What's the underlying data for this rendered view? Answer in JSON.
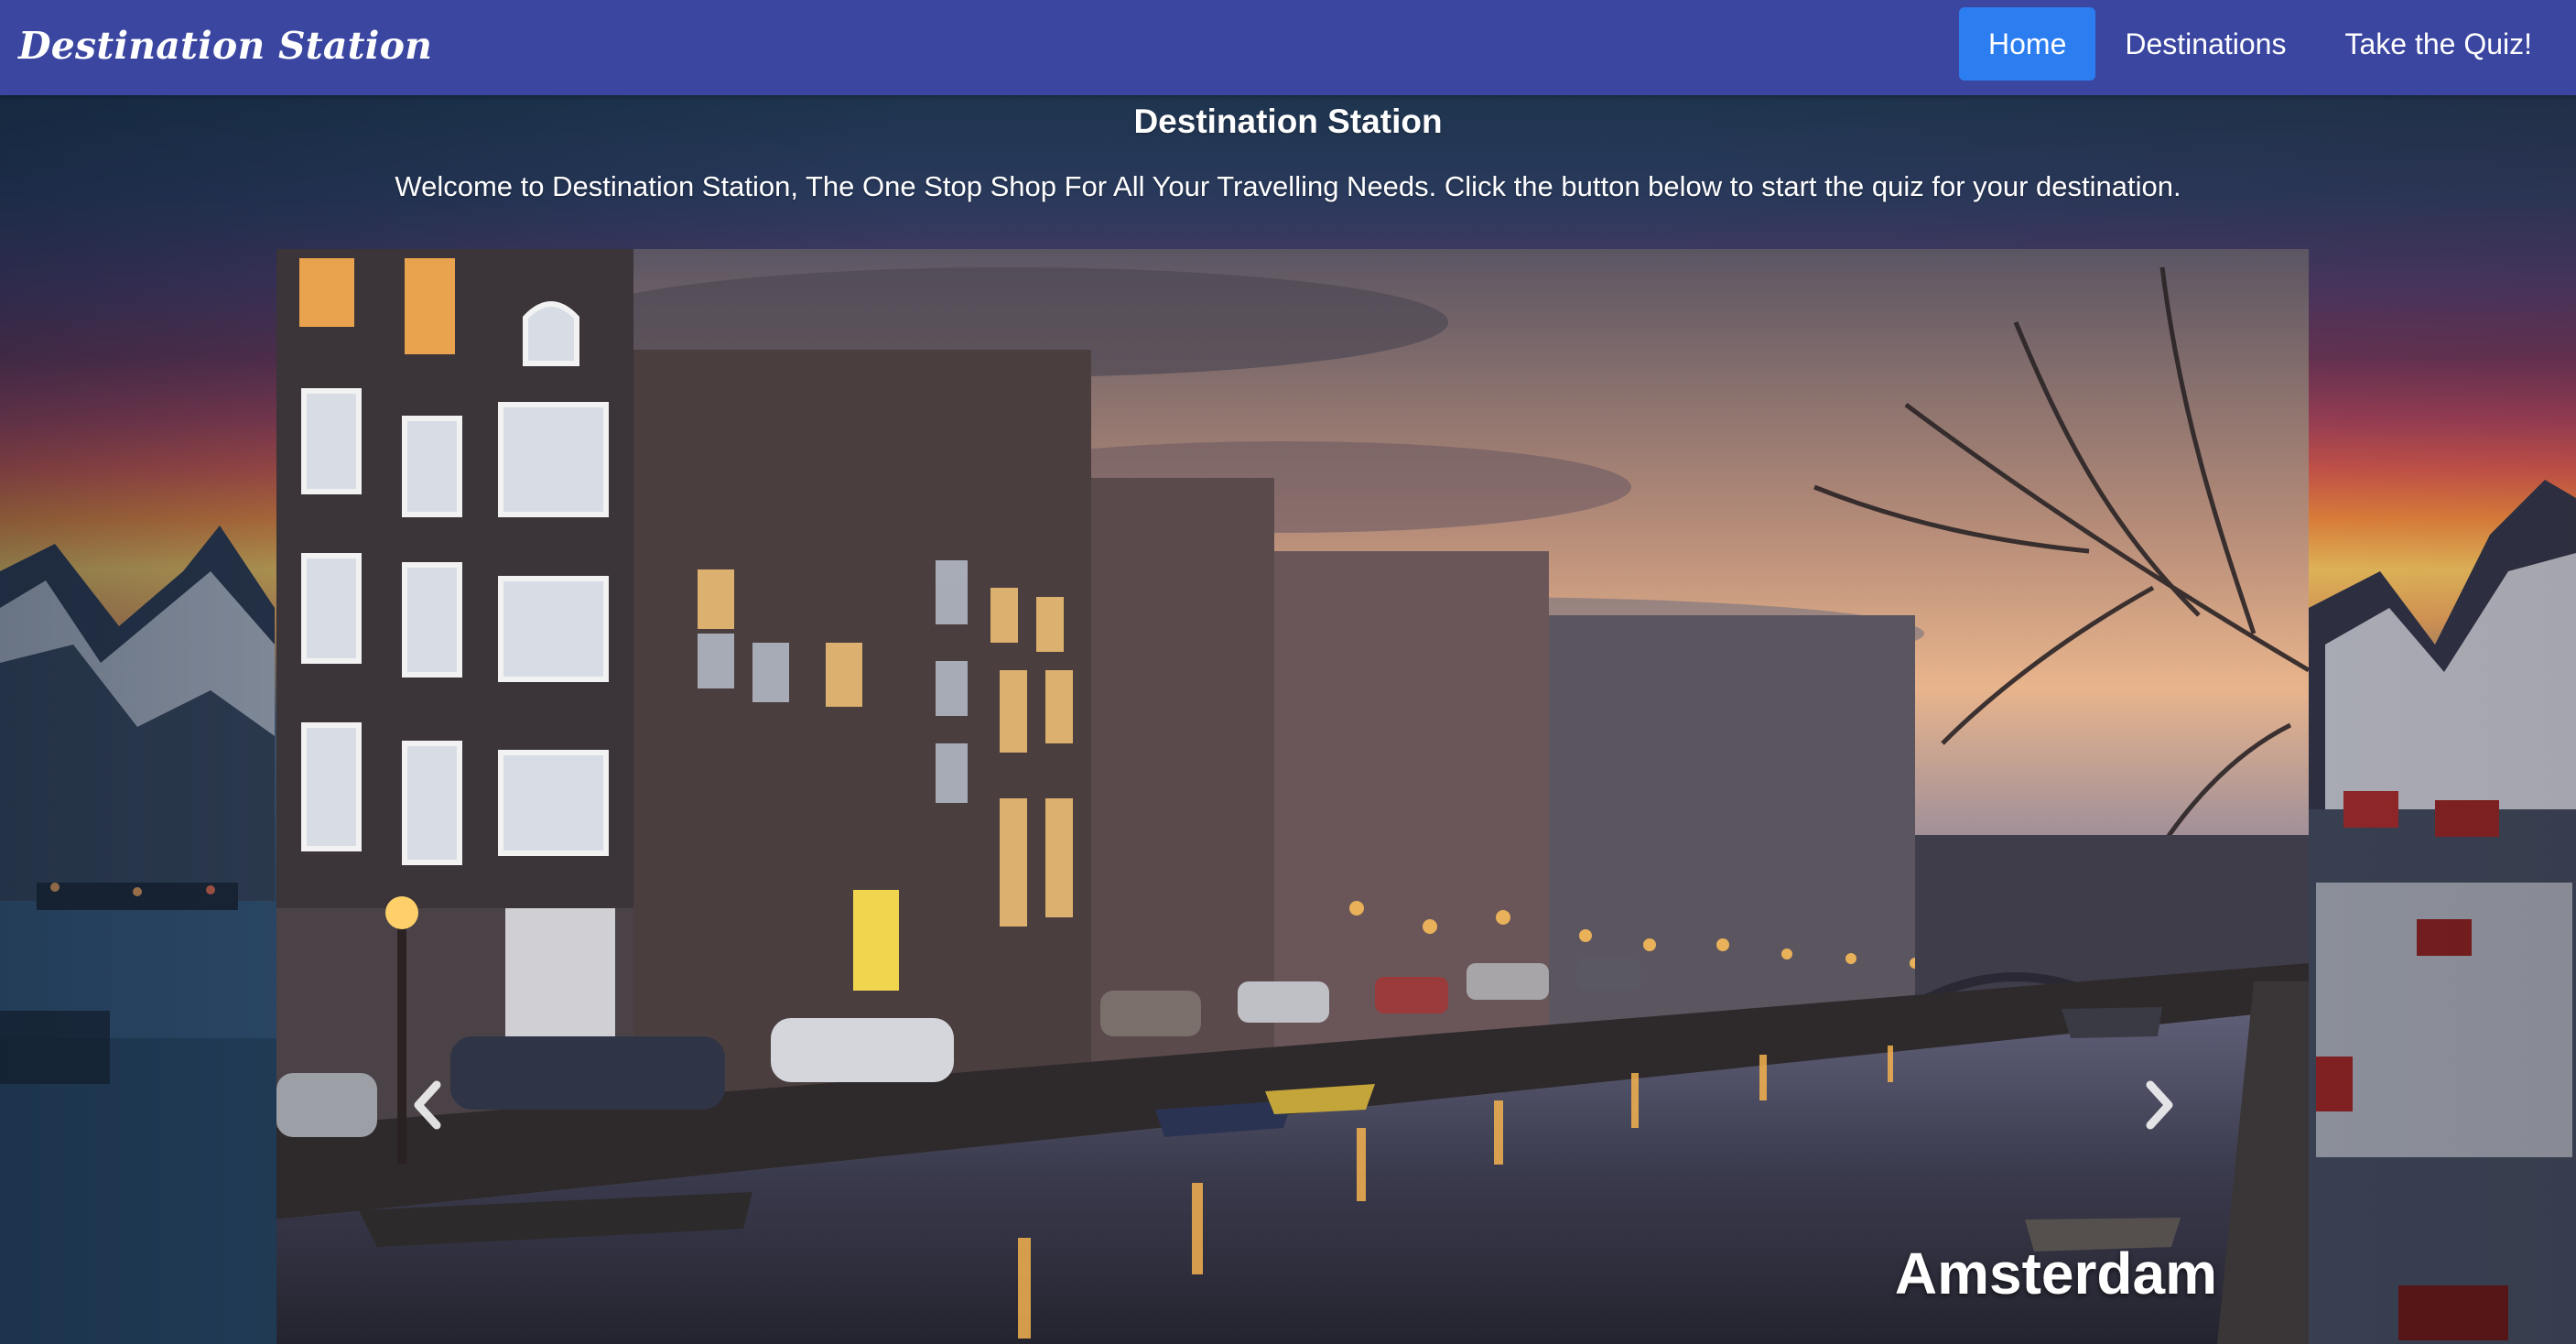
{
  "navbar": {
    "brand": "Destination Station",
    "items": [
      {
        "label": "Home",
        "active": true
      },
      {
        "label": "Destinations",
        "active": false
      },
      {
        "label": "Take the Quiz!",
        "active": false
      }
    ],
    "background_color": "#3b46a1",
    "active_color": "#2c7ef0"
  },
  "hero": {
    "title": "Destination Station",
    "text": "Welcome to Destination Station, The One Stop Shop For All Your Travelling Needs. Click the button below to start the quiz for your destination."
  },
  "carousel": {
    "caption": "Amsterdam",
    "prev_icon": "chevron-left-icon",
    "next_icon": "chevron-right-icon"
  }
}
